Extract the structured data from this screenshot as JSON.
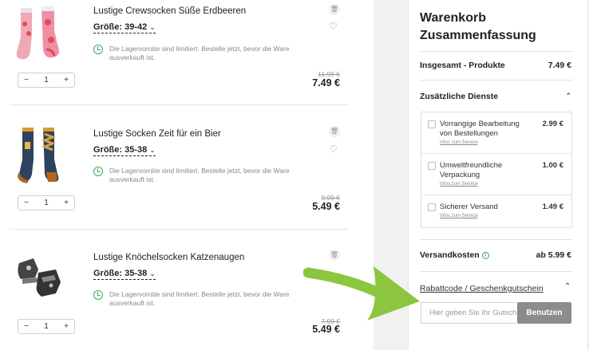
{
  "items": [
    {
      "title": "Lustige Crewsocken Süße Erdbeeren",
      "size_label": "Größe: 39-42",
      "stock_note": "Die Lagervorräte sind limitiert. Bestelle jetzt, bevor die Ware ausverkauft ist.",
      "quantity": "1",
      "old_price": "11.99 €",
      "price": "7.49 €"
    },
    {
      "title": "Lustige Socken Zeit für ein Bier",
      "size_label": "Größe: 35-38",
      "stock_note": "Die Lagervorräte sind limitiert. Bestelle jetzt, bevor die Ware ausverkauft ist.",
      "quantity": "1",
      "old_price": "9.99 €",
      "price": "5.49 €"
    },
    {
      "title": "Lustige Knöchelsocken Katzenaugen",
      "size_label": "Größe: 35-38",
      "stock_note": "Die Lagervorräte sind limitiert. Bestelle jetzt, bevor die Ware ausverkauft ist.",
      "quantity": "1",
      "old_price": "7.99 €",
      "price": "5.49 €"
    }
  ],
  "stepper": {
    "minus": "−",
    "plus": "+"
  },
  "summary": {
    "title": "Warenkorb Zusammenfassung",
    "products_total_label": "Insgesamt - Produkte",
    "products_total_value": "7.49 €",
    "extra_services_label": "Zusätzliche Dienste",
    "services": [
      {
        "name": "Vorrangige Bearbeitung von Bestellungen",
        "price": "2.99 €",
        "info": "Infos zum Service"
      },
      {
        "name": "Umweltfreundliche Verpackung",
        "price": "1.00 €",
        "info": "Infos zum Service"
      },
      {
        "name": "Sicherer Versand",
        "price": "1.49 €",
        "info": "Infos zum Service"
      }
    ],
    "shipping_label": "Versandkosten",
    "shipping_value": "ab 5.99 €",
    "coupon_label": "Rabattcode / Geschenkgutschein",
    "coupon_placeholder": "Hier geben Sie Ihr Gutscheincode ein",
    "coupon_button": "Benutzen"
  },
  "icons": {
    "trash": "trash-icon",
    "heart": "heart-icon",
    "clock": "clock-icon",
    "chevron": "chevron-icon",
    "info": "info-icon",
    "arrow": "green-arrow-annotation"
  },
  "colors": {
    "accent_green": "#3ba85c",
    "arrow_green": "#8cc63f",
    "button_grey": "#8c8c8c",
    "panel_grey": "#f1f1f1"
  }
}
